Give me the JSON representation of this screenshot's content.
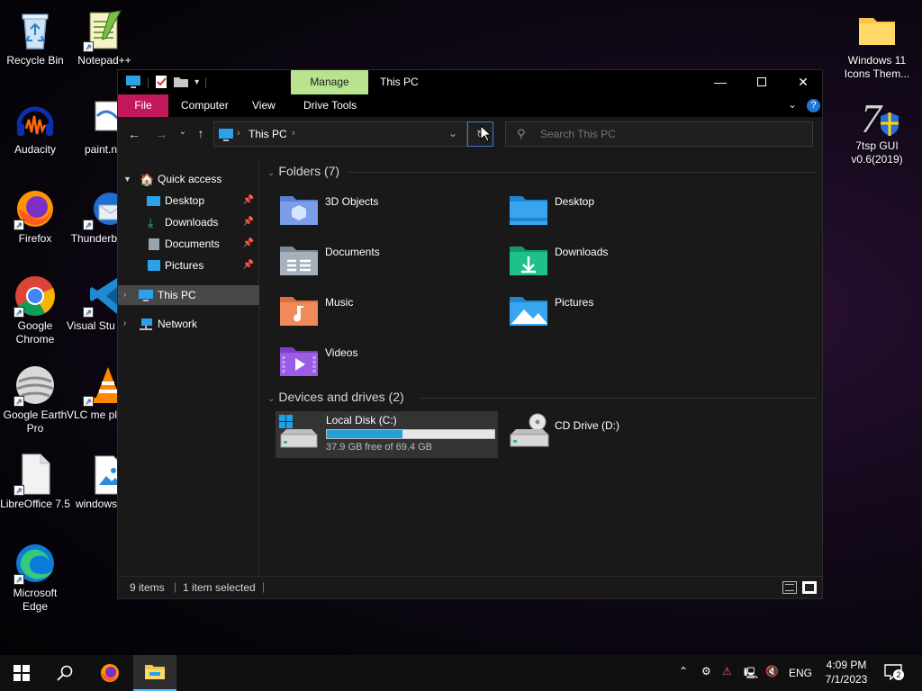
{
  "desktop": {
    "left_column": [
      {
        "label": "Recycle Bin",
        "icon": "recycle-bin-icon"
      },
      {
        "label": "Audacity",
        "icon": "audacity-icon"
      },
      {
        "label": "Firefox",
        "icon": "firefox-icon"
      },
      {
        "label": "Google Chrome",
        "icon": "chrome-icon"
      },
      {
        "label": "Google Earth Pro",
        "icon": "google-earth-icon"
      },
      {
        "label": "LibreOffice 7.5",
        "icon": "libreoffice-icon"
      },
      {
        "label": "Microsoft Edge",
        "icon": "edge-icon"
      }
    ],
    "second_column": [
      {
        "label": "Notepad++",
        "icon": "notepadpp-icon"
      },
      {
        "label": "paint.n",
        "icon": "paintnet-icon"
      },
      {
        "label": "Thunderb",
        "icon": "thunderbird-icon"
      },
      {
        "label": "Visual Stu Code",
        "icon": "vscode-icon"
      },
      {
        "label": "VLC me player",
        "icon": "vlc-icon"
      },
      {
        "label": "windows",
        "icon": "image-file-icon"
      }
    ],
    "right_column": [
      {
        "label": "Windows 11 Icons Them...",
        "icon": "folder-icon"
      },
      {
        "label": "7tsp GUI v0.6(2019)",
        "icon": "7tsp-icon"
      }
    ]
  },
  "window": {
    "title": "This PC",
    "manage_tab": "Manage",
    "ribbon_tabs": [
      "File",
      "Computer",
      "View",
      "Drive Tools"
    ],
    "address": {
      "location": "This PC"
    },
    "search": {
      "placeholder": "Search This PC"
    },
    "nav": {
      "quick_access": "Quick access",
      "quick_items": [
        "Desktop",
        "Downloads",
        "Documents",
        "Pictures"
      ],
      "this_pc": "This PC",
      "network": "Network"
    },
    "folders_header": "Folders (7)",
    "folders": [
      "3D Objects",
      "Desktop",
      "Documents",
      "Downloads",
      "Music",
      "Pictures",
      "Videos"
    ],
    "devices_header": "Devices and drives (2)",
    "drives": [
      {
        "name": "Local Disk (C:)",
        "free_text": "37.9 GB free of 69.4 GB",
        "used_fraction": 0.454
      },
      {
        "name": "CD Drive (D:)"
      }
    ],
    "status": {
      "items": "9 items",
      "selected": "1 item selected"
    }
  },
  "taskbar": {
    "language": "ENG",
    "time": "4:09 PM",
    "date": "7/1/2023",
    "notifications": "2"
  },
  "colors": {
    "accent_file_tab": "#c2185b",
    "manage_tab": "#b9e38f",
    "drive_bar": "#26a0da",
    "selection": "#484848"
  }
}
